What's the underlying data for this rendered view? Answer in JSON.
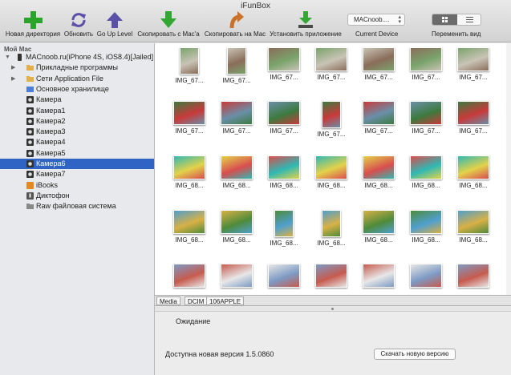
{
  "window": {
    "title": "iFunBox"
  },
  "toolbar": {
    "new_dir": "Новая директория",
    "refresh": "Обновить",
    "go_up": "Go Up Level",
    "copy_to_mac_from": "Скопировать с Mac'а",
    "copy_to_mac": "Скопировать на Мас",
    "install_app": "Установить приложение",
    "device_value": "MACnoob....",
    "device_label": "Current Device",
    "view_label": "Переменить вид"
  },
  "sidebar": {
    "header": "Мой Мас",
    "items": [
      {
        "label": "MACnoob.ru(iPhone 4S, iOS8.4)[Jailed]",
        "icon": "iphone-icon"
      },
      {
        "label": "Прикладные программы",
        "icon": "folder-icon"
      },
      {
        "label": "Сети Application File",
        "icon": "folder-icon"
      },
      {
        "label": "Основное хранилище",
        "icon": "storage-icon"
      },
      {
        "label": "Камера",
        "icon": "camera-icon"
      },
      {
        "label": "Камера1",
        "icon": "camera-icon"
      },
      {
        "label": "Камера2",
        "icon": "camera-icon"
      },
      {
        "label": "Камера3",
        "icon": "camera-icon"
      },
      {
        "label": "Камера4",
        "icon": "camera-icon"
      },
      {
        "label": "Камера5",
        "icon": "camera-icon"
      },
      {
        "label": "Камера6",
        "icon": "camera-icon",
        "selected": true
      },
      {
        "label": "Камера7",
        "icon": "camera-icon"
      },
      {
        "label": "iBooks",
        "icon": "books-icon"
      },
      {
        "label": "Диктофон",
        "icon": "mic-icon"
      },
      {
        "label": "Raw файловая система",
        "icon": "raw-fs-icon"
      }
    ]
  },
  "files": {
    "rows": [
      [
        "IMG_67...",
        "IMG_67...",
        "IMG_67...",
        "IMG_67...",
        "IMG_67...",
        "IMG_67...",
        "IMG_67..."
      ],
      [
        "IMG_67...",
        "IMG_67...",
        "IMG_67...",
        "IMG_67...",
        "IMG_67...",
        "IMG_67...",
        "IMG_67..."
      ],
      [
        "IMG_68...",
        "IMG_68...",
        "IMG_68...",
        "IMG_68...",
        "IMG_68...",
        "IMG_68...",
        "IMG_68..."
      ],
      [
        "IMG_68...",
        "IMG_68...",
        "IMG_68...",
        "IMG_68...",
        "IMG_68...",
        "IMG_68...",
        "IMG_68..."
      ],
      [
        "",
        "",
        "",
        "",
        "",
        "",
        ""
      ]
    ]
  },
  "pathbar": {
    "crumbs": [
      "Media",
      "DCIM",
      "106APPLE"
    ]
  },
  "bottom": {
    "status": "Ожидание",
    "update_text": "Доступна новая версия 1.5.0860",
    "update_button": "Скачать новую версию"
  },
  "colors": {
    "selection": "#2f64c4",
    "new_dir_icon": "#2aa52a",
    "nav_icon": "#5c4fa8",
    "copy_from": "#33a633",
    "copy_to": "#c9722b"
  }
}
